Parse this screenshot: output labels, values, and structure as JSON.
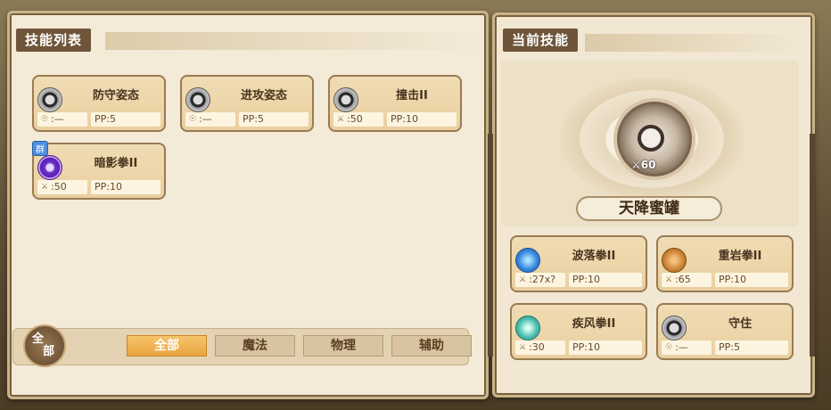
{
  "left_panel": {
    "title": "技能列表",
    "skills": [
      {
        "name": "防守姿态",
        "stat": ":—",
        "pp": "PP:5",
        "icon": "normal-orb-icon"
      },
      {
        "name": "进攻姿态",
        "stat": ":—",
        "pp": "PP:5",
        "icon": "normal-orb-icon"
      },
      {
        "name": "撞击II",
        "stat": ":50",
        "pp": "PP:10",
        "icon": "normal-orb-icon"
      },
      {
        "name": "暗影拳II",
        "stat": ":50",
        "pp": "PP:10",
        "icon": "shadow-orb-icon",
        "tag": "群"
      }
    ],
    "filter_badge": {
      "line1": "全",
      "line2": "部"
    },
    "tabs": [
      "全部",
      "魔法",
      "物理",
      "辅助"
    ],
    "active_tab": 0
  },
  "right_panel": {
    "title": "当前技能",
    "current": {
      "name": "天降蜜罐",
      "pp": "60"
    },
    "skills": [
      {
        "name": "波落拳II",
        "stat": ":27x?",
        "pp": "PP:10",
        "icon": "water-drop-icon"
      },
      {
        "name": "重岩拳II",
        "stat": ":65",
        "pp": "PP:10",
        "icon": "rock-fist-icon"
      },
      {
        "name": "疾风拳II",
        "stat": ":30",
        "pp": "PP:10",
        "icon": "wind-swirl-icon"
      },
      {
        "name": "守住",
        "stat": ":—",
        "pp": "PP:5",
        "icon": "normal-orb-icon"
      }
    ]
  }
}
